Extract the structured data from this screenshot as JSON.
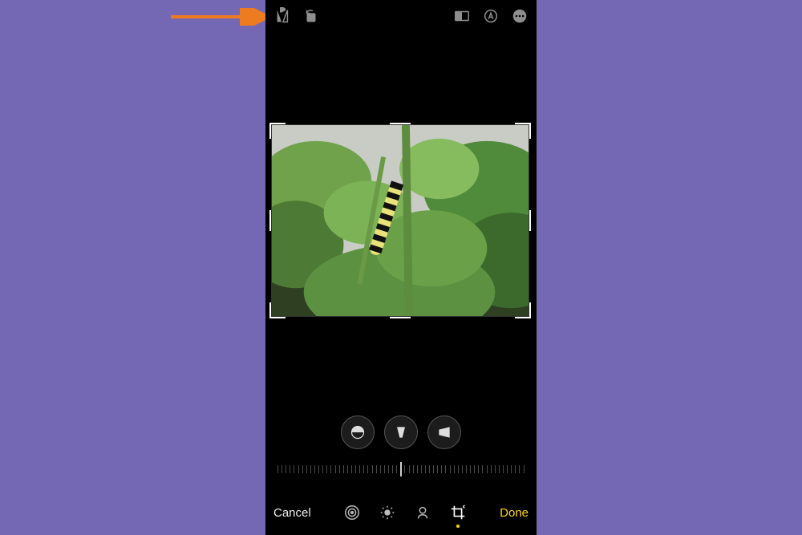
{
  "bottom": {
    "cancel": "Cancel",
    "done": "Done"
  },
  "icons": {
    "flip": "flip-horizontal-icon",
    "rotate": "rotate-icon",
    "aspect": "aspect-ratio-icon",
    "markup": "markup-icon",
    "more": "more-icon",
    "straighten": "straighten-icon",
    "persp_h": "perspective-horizontal-icon",
    "persp_v": "perspective-vertical-icon",
    "adjust": "adjust-icon",
    "filters": "filters-icon",
    "portrait_light": "portrait-light-icon",
    "crop": "crop-rotate-icon"
  }
}
